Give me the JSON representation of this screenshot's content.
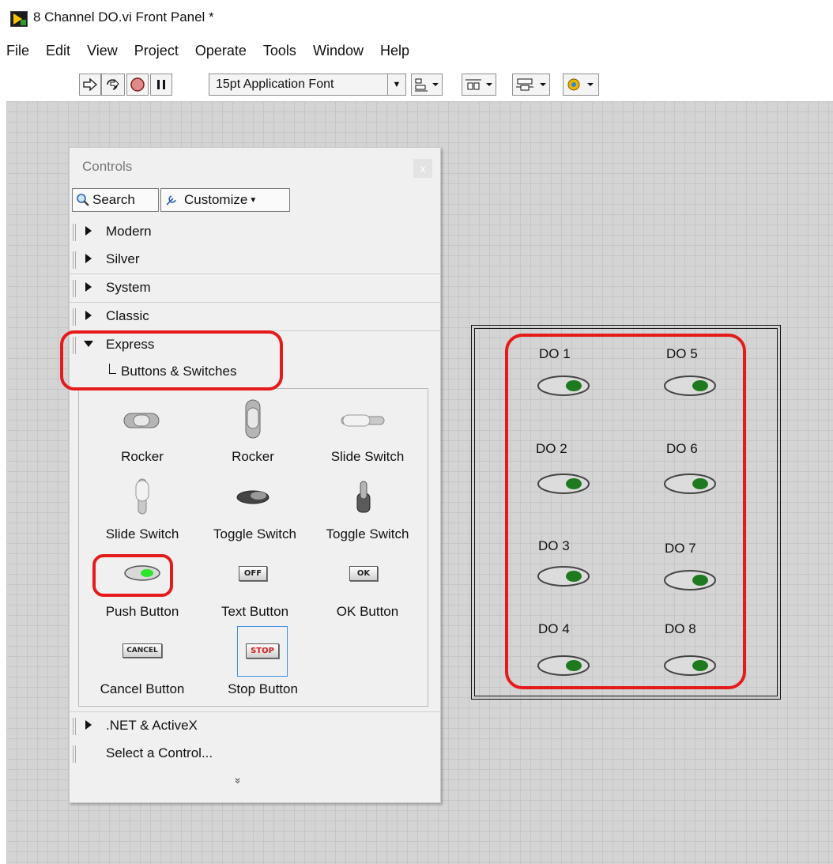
{
  "window": {
    "title": "8 Channel DO.vi Front Panel *"
  },
  "menu": [
    "File",
    "Edit",
    "View",
    "Project",
    "Operate",
    "Tools",
    "Window",
    "Help"
  ],
  "toolbar": {
    "font_select": "15pt Application Font"
  },
  "palette": {
    "title": "Controls",
    "close": "x",
    "search_label": "Search",
    "customize_label": "Customize",
    "categories_top": [
      "Modern",
      "Silver",
      "System",
      "Classic"
    ],
    "expanded": "Express",
    "subcategory": "Buttons & Switches",
    "items": [
      "Rocker",
      "Rocker",
      "Slide Switch",
      "Slide Switch",
      "Toggle Switch",
      "Toggle Switch",
      "Push Button",
      "Text Button",
      "OK Button",
      "Cancel Button",
      "Stop Button"
    ],
    "icon_text": {
      "off": "OFF",
      "ok": "OK",
      "cancel": "CANCEL",
      "stop": "STOP"
    },
    "categories_bottom": [
      ".NET & ActiveX",
      "Select a Control..."
    ],
    "more_glyph": "»"
  },
  "front_panel": {
    "labels": [
      "DO 1",
      "DO 2",
      "DO 3",
      "DO 4",
      "DO 5",
      "DO 6",
      "DO 7",
      "DO 8"
    ]
  },
  "colors": {
    "annotation_red": "#e51b1b",
    "grid": "#d4d4d4",
    "led_dark_green": "#1f7a1f",
    "led_bright_green": "#2ee52e"
  }
}
